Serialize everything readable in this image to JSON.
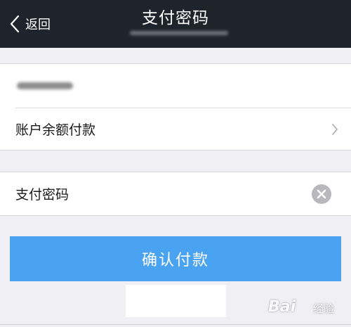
{
  "nav": {
    "back_label": "返回",
    "title": "支付密码"
  },
  "payment": {
    "balance_label": "账户余额付款",
    "password_label": "支付密码",
    "password_value": ""
  },
  "actions": {
    "confirm_label": "确认付款"
  },
  "watermark": {
    "text": "Bai",
    "suffix": "经验"
  },
  "colors": {
    "navbar": "#1f232b",
    "background": "#efeff4",
    "confirm_button": "#4aa3f0",
    "clear_icon": "#b8b8bd"
  },
  "icons": {
    "back": "chevron-left-icon",
    "row_arrow": "chevron-right-icon",
    "clear": "clear-icon"
  }
}
